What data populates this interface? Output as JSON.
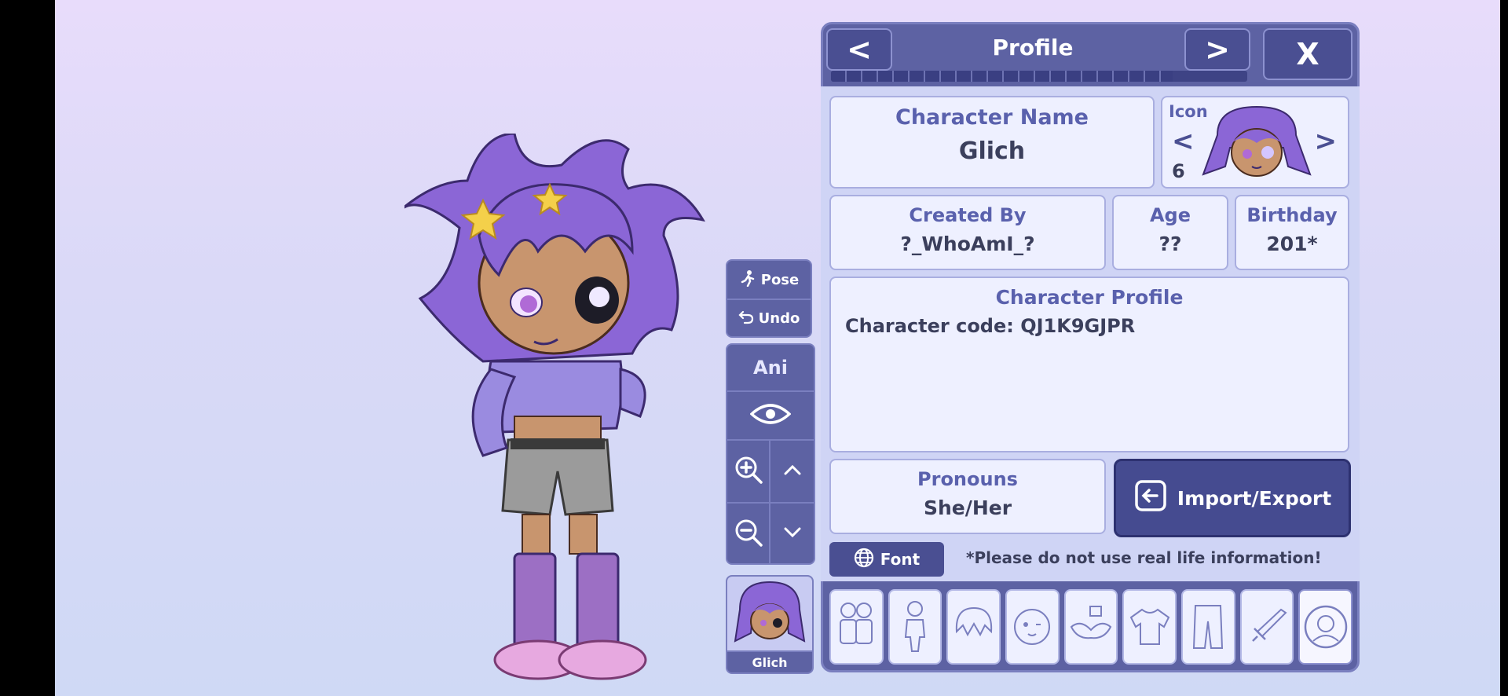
{
  "panel": {
    "title": "Profile",
    "prev_label": "<",
    "next_label": ">",
    "close_label": "X",
    "progress": 0.82
  },
  "name_card": {
    "caption": "Character Name",
    "value": "Glich"
  },
  "icon_card": {
    "caption": "Icon",
    "prev": "<",
    "next": ">",
    "number": "6"
  },
  "created_by": {
    "caption": "Created By",
    "value": "?_WhoAmI_?"
  },
  "age": {
    "caption": "Age",
    "value": "??"
  },
  "birthday": {
    "caption": "Birthday",
    "value": "201*"
  },
  "profile": {
    "caption": "Character Profile",
    "text": "Character code: QJ1K9GJPR"
  },
  "pronouns": {
    "caption": "Pronouns",
    "value": "She/Her"
  },
  "import_export": {
    "label": "Import/Export",
    "icon": "import-export-icon"
  },
  "font_button": {
    "label": "Font",
    "icon": "globe-icon"
  },
  "notice": "*Please do not use real life information!",
  "side": {
    "pose_label": "Pose",
    "undo_label": "Undo",
    "ani_label": "Ani",
    "character_label": "Glich"
  },
  "tabs": [
    {
      "name": "characters-tab",
      "icon": "characters-icon"
    },
    {
      "name": "body-tab",
      "icon": "body-icon"
    },
    {
      "name": "hair-tab",
      "icon": "hair-icon"
    },
    {
      "name": "face-tab",
      "icon": "face-icon"
    },
    {
      "name": "accessories-tab",
      "icon": "accessories-icon"
    },
    {
      "name": "tops-tab",
      "icon": "shirt-icon"
    },
    {
      "name": "bottoms-tab",
      "icon": "pants-icon"
    },
    {
      "name": "props-tab",
      "icon": "sword-icon"
    },
    {
      "name": "profile-tab",
      "icon": "profile-icon",
      "active": true
    }
  ],
  "colors": {
    "panel": "#5d62a3",
    "panel_dark": "#4a4f92",
    "content_bg": "#cfd4f5",
    "card_bg": "#eef0ff",
    "caption_text": "#5a61ad",
    "value_text": "#3b3f5c",
    "hair": "#8b66d6"
  }
}
